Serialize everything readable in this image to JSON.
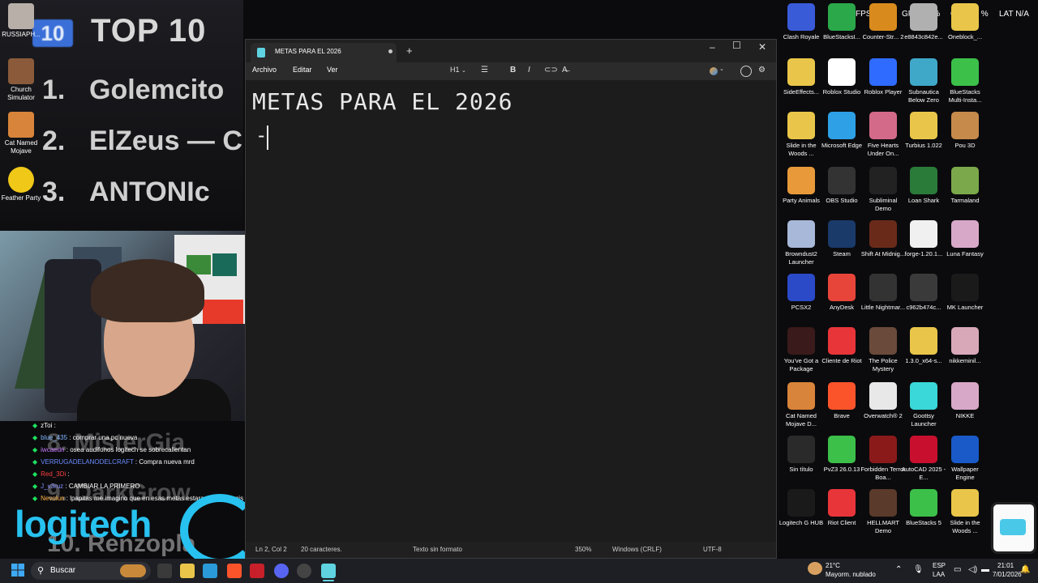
{
  "stream_overlay": {
    "badge": "10",
    "title": "TOP 10",
    "ranks": [
      {
        "num": "1.",
        "name": "Golemcito"
      },
      {
        "num": "2.",
        "name": "ElZeus — C"
      },
      {
        "num": "3.",
        "name": "ANTONIc"
      }
    ],
    "ghost_rank_8": "8. MisterGia",
    "ghost_rank_9": "9. DarkGrow",
    "ghost_rank_10": "10. Renzopla"
  },
  "left_icons": [
    {
      "label": "RUSSIAPH..."
    },
    {
      "label": "Church Simulator"
    },
    {
      "label": "Cat Named Mojave"
    },
    {
      "label": "Feather Party"
    }
  ],
  "chat": [
    {
      "user": "zToi",
      "user_color": "#ffffff",
      "msg": ""
    },
    {
      "user": "blue_435",
      "user_color": "#7fb6ff",
      "msg": "comprar una pc nueva"
    },
    {
      "user": "iwcaedn",
      "user_color": "#c97bff",
      "msg": "osea audifonos logitech se sobrecalientan"
    },
    {
      "user": "VERRUGADELANODELCRAFT",
      "user_color": "#6b8cff",
      "msg": "Compra  nueva mrd"
    },
    {
      "user": "Red_3Di",
      "user_color": "#ff4040",
      "msg": ""
    },
    {
      "user": "J_v3ruz",
      "user_color": "#7f8cff",
      "msg": "CAMBIAR LA  PRIMERO"
    },
    {
      "user": "Nevolun",
      "user_color": "#ffb347",
      "msg": "lpapitas me imagino que en esas metas estara pagarme mis 20 soles"
    }
  ],
  "sponsor": "logitech",
  "notepad": {
    "tab_title": "METAS PARA EL 2026",
    "menu": [
      "Archivo",
      "Editar",
      "Ver"
    ],
    "heading_tool": "H1",
    "content_line1": "METAS PARA EL 2026",
    "content_line2": "-",
    "status": {
      "position": "Ln 2, Col 2",
      "chars": "20 caracteres.",
      "format": "Texto sin formato",
      "zoom": "350%",
      "line_ending": "Windows (CRLF)",
      "encoding": "UTF-8"
    }
  },
  "hud": {
    "fps": "FPS N/A",
    "gpu": "GPU 22 %",
    "cpu": "CPU 15 %",
    "lat": "LAT N/A"
  },
  "desktop_icons": [
    {
      "label": "Clash Royale",
      "color": "#3a5bd8"
    },
    {
      "label": "BlueStacksI...",
      "color": "#2aa84a"
    },
    {
      "label": "Counter-Str... 2",
      "color": "#d88a1c"
    },
    {
      "label": "e8843c842e...",
      "color": "#b0b0b0"
    },
    {
      "label": "Oneblock_...",
      "color": "#e9c64a"
    },
    {
      "label": "SideEffects...",
      "color": "#e9c64a"
    },
    {
      "label": "Roblox Studio",
      "color": "#ffffff"
    },
    {
      "label": "Roblox Player",
      "color": "#2f6bff"
    },
    {
      "label": "Subnautica Below Zero",
      "color": "#3fa8c8"
    },
    {
      "label": "BlueStacks Multi-Insta...",
      "color": "#3cc04a"
    },
    {
      "label": "Slide in the Woods ...",
      "color": "#e9c64a"
    },
    {
      "label": "Microsoft Edge",
      "color": "#2ea0e6"
    },
    {
      "label": "Five Hearts Under On...",
      "color": "#d46a8a"
    },
    {
      "label": "Turbius 1.022",
      "color": "#e9c64a"
    },
    {
      "label": "Pou 3D",
      "color": "#c68a4a"
    },
    {
      "label": "Party Animals",
      "color": "#e89a3a"
    },
    {
      "label": "OBS Studio",
      "color": "#333333"
    },
    {
      "label": "Subliminal Demo",
      "color": "#222222"
    },
    {
      "label": "Loan Shark",
      "color": "#2a7a3a"
    },
    {
      "label": "Tarmaland",
      "color": "#7aa84a"
    },
    {
      "label": "Browndust2 Launcher",
      "color": "#a8b8d8"
    },
    {
      "label": "Steam",
      "color": "#1a3a6a"
    },
    {
      "label": "Shift At Midnig...",
      "color": "#6a2a1a"
    },
    {
      "label": "forge-1.20.1...",
      "color": "#f0f0f0"
    },
    {
      "label": "Luna Fantasy",
      "color": "#d8a8c8"
    },
    {
      "label": "PCSX2",
      "color": "#2a4ac8"
    },
    {
      "label": "AnyDesk",
      "color": "#e8453a"
    },
    {
      "label": "Little Nightmar...",
      "color": "#333333"
    },
    {
      "label": "c962b474c...",
      "color": "#3a3a3a"
    },
    {
      "label": "MK Launcher",
      "color": "#1a1a1a"
    },
    {
      "label": "You've Got a Package",
      "color": "#3a1a1a"
    },
    {
      "label": "Cliente de Riot",
      "color": "#e8353a"
    },
    {
      "label": "The Police Mystery",
      "color": "#6a4a3a"
    },
    {
      "label": "1.3.0_x64-s...",
      "color": "#e9c64a"
    },
    {
      "label": "nikkeminil...",
      "color": "#d8a8b8"
    },
    {
      "label": "Cat Named Mojave D...",
      "color": "#d8843a"
    },
    {
      "label": "Brave",
      "color": "#fb542b"
    },
    {
      "label": "Overwatch® 2",
      "color": "#e8e8e8"
    },
    {
      "label": "Goottsy Launcher",
      "color": "#3ad8d8"
    },
    {
      "label": "NIKKE",
      "color": "#d8a8c8"
    },
    {
      "label": "Sin título",
      "color": "#2a2a2a"
    },
    {
      "label": "PvZ3 26.0.13",
      "color": "#3cc04a"
    },
    {
      "label": "Forbidden Terror Boa...",
      "color": "#8a1a1a"
    },
    {
      "label": "AutoCAD 2025 - E...",
      "color": "#c8102e"
    },
    {
      "label": "Wallpaper Engine",
      "color": "#1a5ac8"
    },
    {
      "label": "Logitech G HUB",
      "color": "#1a1a1a"
    },
    {
      "label": "Riot Client",
      "color": "#e8353a"
    },
    {
      "label": "HELLMART Demo",
      "color": "#5a3a2a"
    },
    {
      "label": "BlueStacks 5",
      "color": "#3cc04a"
    },
    {
      "label": "Slide in the Woods ...",
      "color": "#e9c64a"
    }
  ],
  "taskbar": {
    "search_placeholder": "Buscar",
    "weather_temp": "21°C",
    "weather_desc": "Mayorm. nublado",
    "lang1": "ESP",
    "lang2": "LAA",
    "time": "21:01",
    "date": "7/01/2026"
  }
}
